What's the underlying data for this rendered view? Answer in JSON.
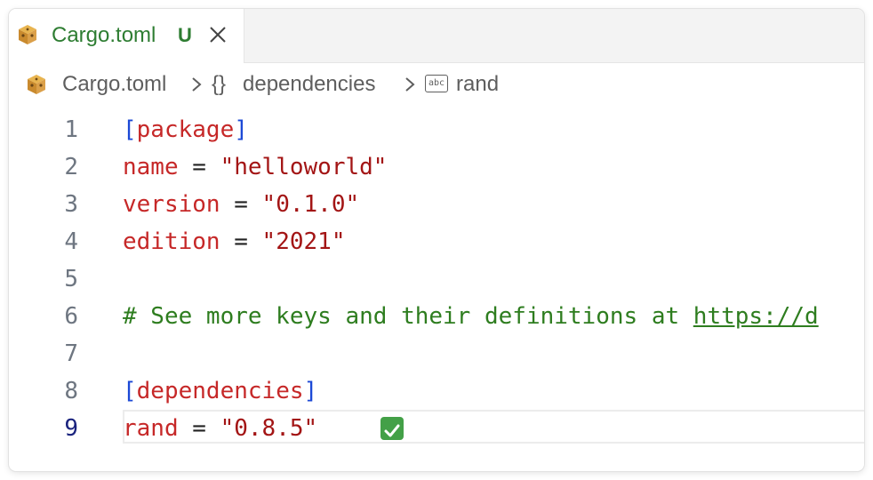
{
  "tab": {
    "title": "Cargo.toml",
    "status": "U",
    "icon": "cargo-crate-icon",
    "close_icon": "close-icon"
  },
  "breadcrumb": {
    "file": "Cargo.toml",
    "section_icon": "{}",
    "section": "dependencies",
    "key_icon": "abc",
    "key": "rand"
  },
  "editor": {
    "active_line": 9,
    "lines": [
      {
        "n": "1",
        "parts": [
          [
            "bracket",
            "["
          ],
          [
            "table",
            "package"
          ],
          [
            "bracket",
            "]"
          ]
        ]
      },
      {
        "n": "2",
        "parts": [
          [
            "key",
            "name"
          ],
          [
            "op",
            " = "
          ],
          [
            "str",
            "\"helloworld\""
          ]
        ]
      },
      {
        "n": "3",
        "parts": [
          [
            "key",
            "version"
          ],
          [
            "op",
            " = "
          ],
          [
            "str",
            "\"0.1.0\""
          ]
        ]
      },
      {
        "n": "4",
        "parts": [
          [
            "key",
            "edition"
          ],
          [
            "op",
            " = "
          ],
          [
            "str",
            "\"2021\""
          ]
        ]
      },
      {
        "n": "5",
        "parts": []
      },
      {
        "n": "6",
        "parts": [
          [
            "comment",
            "# See more keys and their definitions at "
          ],
          [
            "link",
            "https://d"
          ]
        ]
      },
      {
        "n": "7",
        "parts": []
      },
      {
        "n": "8",
        "parts": [
          [
            "bracket",
            "["
          ],
          [
            "table",
            "dependencies"
          ],
          [
            "bracket",
            "]"
          ]
        ]
      },
      {
        "n": "9",
        "parts": [
          [
            "key",
            "rand"
          ],
          [
            "op",
            " = "
          ],
          [
            "str",
            "\"0.8.5\""
          ]
        ]
      }
    ],
    "inlay_icon": "check-mark-icon"
  },
  "colors": {
    "bracket": "#1c49d6",
    "key": "#c62828",
    "string": "#a31515",
    "comment": "#2e7d1f",
    "git_untracked": "#2e7d32",
    "check": "#43a047"
  }
}
